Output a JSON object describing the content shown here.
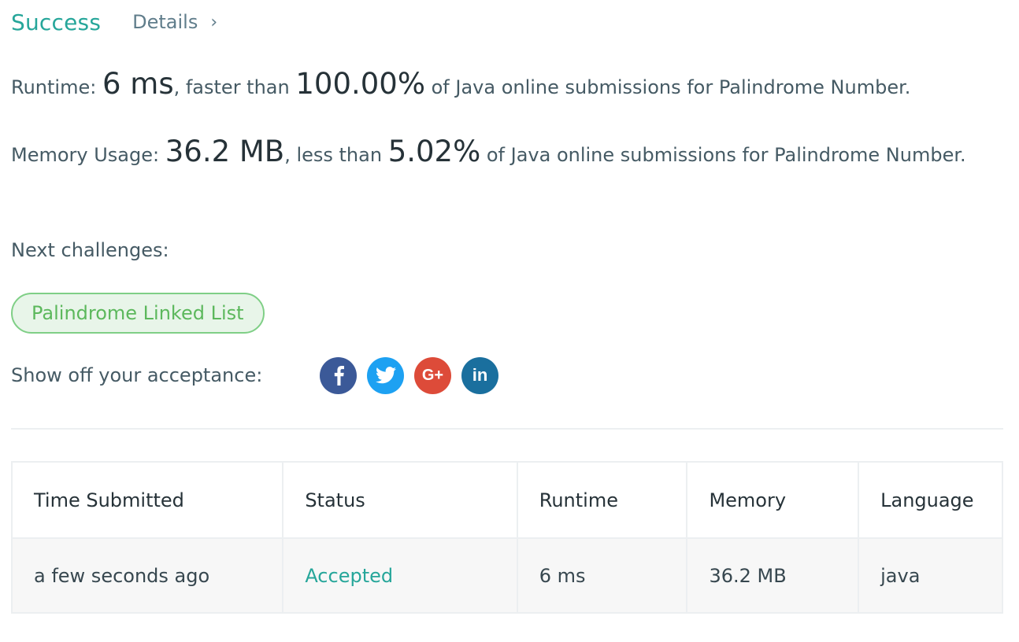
{
  "result": {
    "status": "Success",
    "details_label": "Details",
    "details_chevron": "›"
  },
  "runtime": {
    "label": "Runtime: ",
    "value": "6 ms",
    "middle": ", faster than ",
    "percent": "100.00%",
    "suffix": " of Java online submissions for Palindrome Number."
  },
  "memory": {
    "label": "Memory Usage: ",
    "value": "36.2 MB",
    "middle": ", less than ",
    "percent": "5.02%",
    "suffix": " of Java online submissions for Palindrome Number."
  },
  "next_challenges": {
    "label": "Next challenges:",
    "items": [
      "Palindrome Linked List"
    ]
  },
  "share": {
    "label": "Show off your acceptance:",
    "icons": [
      {
        "name": "facebook-icon",
        "glyph": "f",
        "color": "#3b5998"
      },
      {
        "name": "twitter-icon",
        "glyph": "t",
        "color": "#1da1f2"
      },
      {
        "name": "google-plus-icon",
        "glyph": "G+",
        "color": "#dd4b39"
      },
      {
        "name": "linkedin-icon",
        "glyph": "in",
        "color": "#1a6f9e"
      }
    ]
  },
  "submissions": {
    "columns": [
      "Time Submitted",
      "Status",
      "Runtime",
      "Memory",
      "Language"
    ],
    "rows": [
      {
        "time": "a few seconds ago",
        "status": "Accepted",
        "runtime": "6 ms",
        "memory": "36.2 MB",
        "language": "java"
      }
    ]
  },
  "colors": {
    "success": "#26a69a",
    "accepted": "#26a69a",
    "pill_border": "#7fcf86",
    "pill_text": "#5cb85c"
  }
}
